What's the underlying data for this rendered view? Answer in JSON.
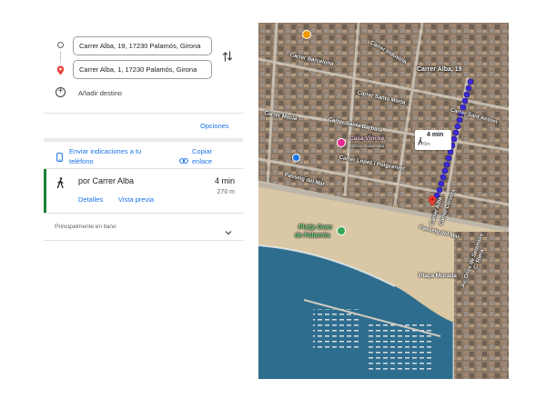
{
  "directions": {
    "origin_value": "Carrer Alba, 19, 17230 Palamós, Girona",
    "destination_value": "Carrer Alba, 1, 17230 Palamós, Girona",
    "add_destination_label": "Añadir destino",
    "options_label": "Opciones",
    "send_to_phone_label": [
      "Enviar indicaciones a tu",
      "teléfono"
    ],
    "copy_link_label": [
      "Copiar",
      "enlace"
    ]
  },
  "route": {
    "title": "por Carrer Alba",
    "time": "4 min",
    "distance": "270 m",
    "details_label": "Detalles",
    "preview_label": "Vista previa",
    "terrain_note": "Principalmente en llano"
  },
  "map": {
    "callout_time": "4 min",
    "callout_distance": "270m",
    "labels": {
      "carrer_alba_19": "Carrer Alba, 19",
      "carrer_barcelona": "Carrer Barcelona",
      "carrer_industria": "Carrer Industria",
      "carrer_santa_marta": "Carrer Santa Marta",
      "carrer_sant_antoni": "Carrer Sant Antoni",
      "carrer_santa_barbara": "Carrer Santa Barbara",
      "carrer_macia": "Carrer Macia",
      "carrer_lopez_puigcerver": "Carrer López i Puigcerver",
      "passeig_del_mar": "Passeig del Mar",
      "passeig_del_mar_2": "Passeig del Mar",
      "casa_vincke": "Casa Vincke",
      "casa_vincke_sub": "Edificio modernista",
      "platja_gran": "Platja Gran",
      "platja_gran_2": "de Palamós",
      "placa_murada": "Plaça Murada",
      "av_onze": "Av. Onze de Setembre",
      "carrer_cervera": "Carrer Cervera",
      "carrer_alba_1": "Carrer Alba",
      "carrer_riera": "C. Riera"
    }
  },
  "colors": {
    "accent": "#1a73e8",
    "route_selected": "#188038",
    "route_dot": "#3c2bd9",
    "pin": "#ea4335",
    "sea": "#2f6d8e",
    "sand": "#d9c7a5"
  }
}
